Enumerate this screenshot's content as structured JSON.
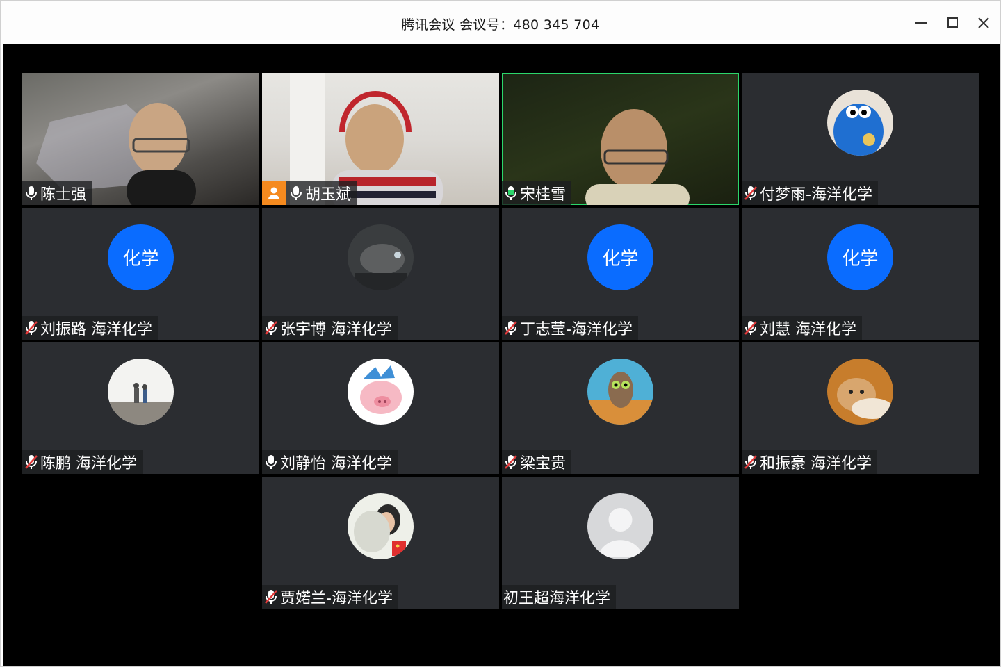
{
  "window": {
    "title": "腾讯会议 会议号：480 345 704"
  },
  "participants": [
    {
      "name": "陈士强",
      "mic": "on",
      "display": "video"
    },
    {
      "name": "胡玉斌",
      "mic": "on",
      "display": "video",
      "host": true
    },
    {
      "name": "宋桂雪",
      "mic": "speaking",
      "display": "video",
      "active_speaker": true
    },
    {
      "name": "付梦雨-海洋化学",
      "mic": "muted",
      "display": "avatar",
      "avatar_icon": "cookie-monster-avatar"
    },
    {
      "name": "刘振路 海洋化学",
      "mic": "muted",
      "display": "text-avatar",
      "avatar_text": "化学"
    },
    {
      "name": "张宇博 海洋化学",
      "mic": "muted",
      "display": "avatar",
      "avatar_icon": "dark-creature-avatar"
    },
    {
      "name": "丁志莹-海洋化学",
      "mic": "muted",
      "display": "text-avatar",
      "avatar_text": "化学"
    },
    {
      "name": "刘慧 海洋化学",
      "mic": "muted",
      "display": "text-avatar",
      "avatar_text": "化学"
    },
    {
      "name": "陈鹏 海洋化学",
      "mic": "muted",
      "display": "avatar",
      "avatar_icon": "beach-children-avatar"
    },
    {
      "name": "刘静怡 海洋化学",
      "mic": "on",
      "display": "avatar",
      "avatar_icon": "cartoon-pig-avatar"
    },
    {
      "name": "梁宝贵",
      "mic": "muted",
      "display": "avatar",
      "avatar_icon": "owl-avatar"
    },
    {
      "name": "和振豪 海洋化学",
      "mic": "muted",
      "display": "avatar",
      "avatar_icon": "shiba-dog-avatar"
    },
    {
      "name": "贾婼兰-海洋化学",
      "mic": "muted",
      "display": "avatar",
      "avatar_icon": "woman-flowers-avatar"
    },
    {
      "name": "初王超海洋化学",
      "mic": "none",
      "display": "avatar",
      "avatar_icon": "default-user-avatar"
    }
  ],
  "colors": {
    "text_avatar_bg": "#0a6cff",
    "tile_bg": "#2b2d31",
    "active_border": "#2bd66b",
    "host_badge": "#f58a1f",
    "muted_slash": "#e03a3a"
  }
}
